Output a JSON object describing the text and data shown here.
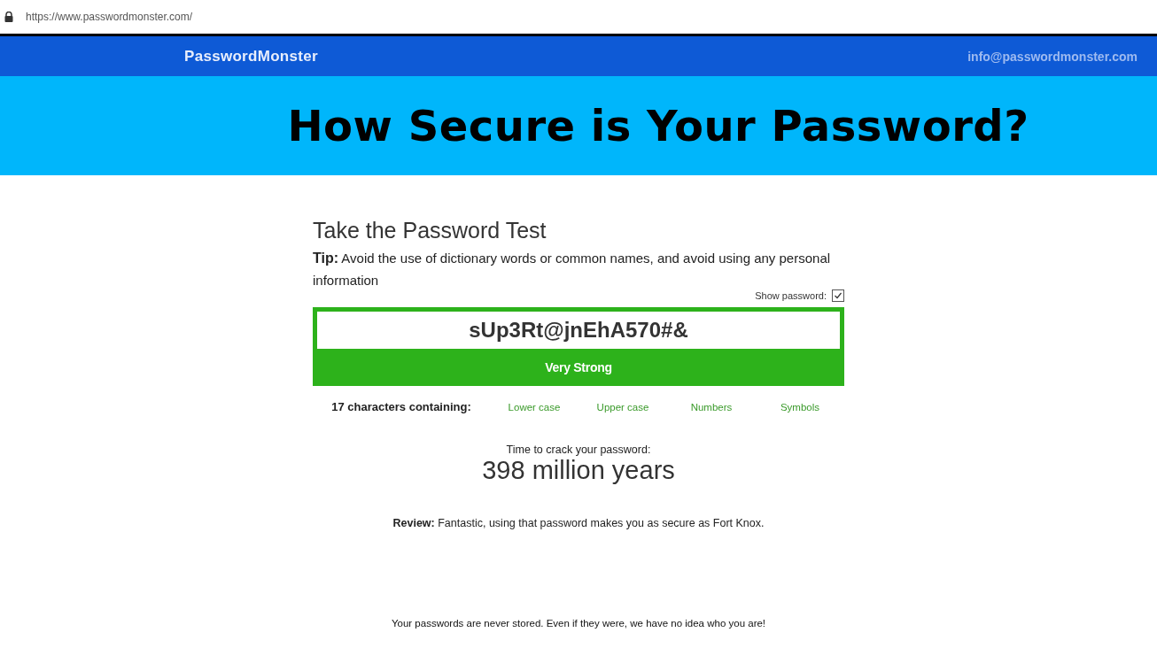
{
  "address_bar": {
    "url": "https://www.passwordmonster.com/"
  },
  "header": {
    "brand": "PasswordMonster",
    "email": "info@passwordmonster.com"
  },
  "hero": {
    "title": "How Secure is Your Password?"
  },
  "test": {
    "heading": "Take the Password Test",
    "tip": "**Tip:** Avoid the use of dictionary words or common names, and avoid using any personal information",
    "show_password": {
      "label": "Show password:",
      "checked": true
    },
    "password": {
      "value": "sUp3Rt@jnEhA570#&"
    },
    "strength": "Very Strong",
    "count": "17 characters containing:",
    "classes": [
      {
        "label": "Lower case",
        "present": true
      },
      {
        "label": "Upper case",
        "present": true
      },
      {
        "label": "Numbers",
        "present": true
      },
      {
        "label": "Symbols",
        "present": true
      }
    ],
    "crack_label": "Time to crack your password:",
    "crack_time": "398 million years",
    "review": "**Review:** Fantastic, using that password makes you as secure as Fort Knox."
  },
  "footer": "Your passwords are never stored. Even if they were, we have no idea who you are!"
}
